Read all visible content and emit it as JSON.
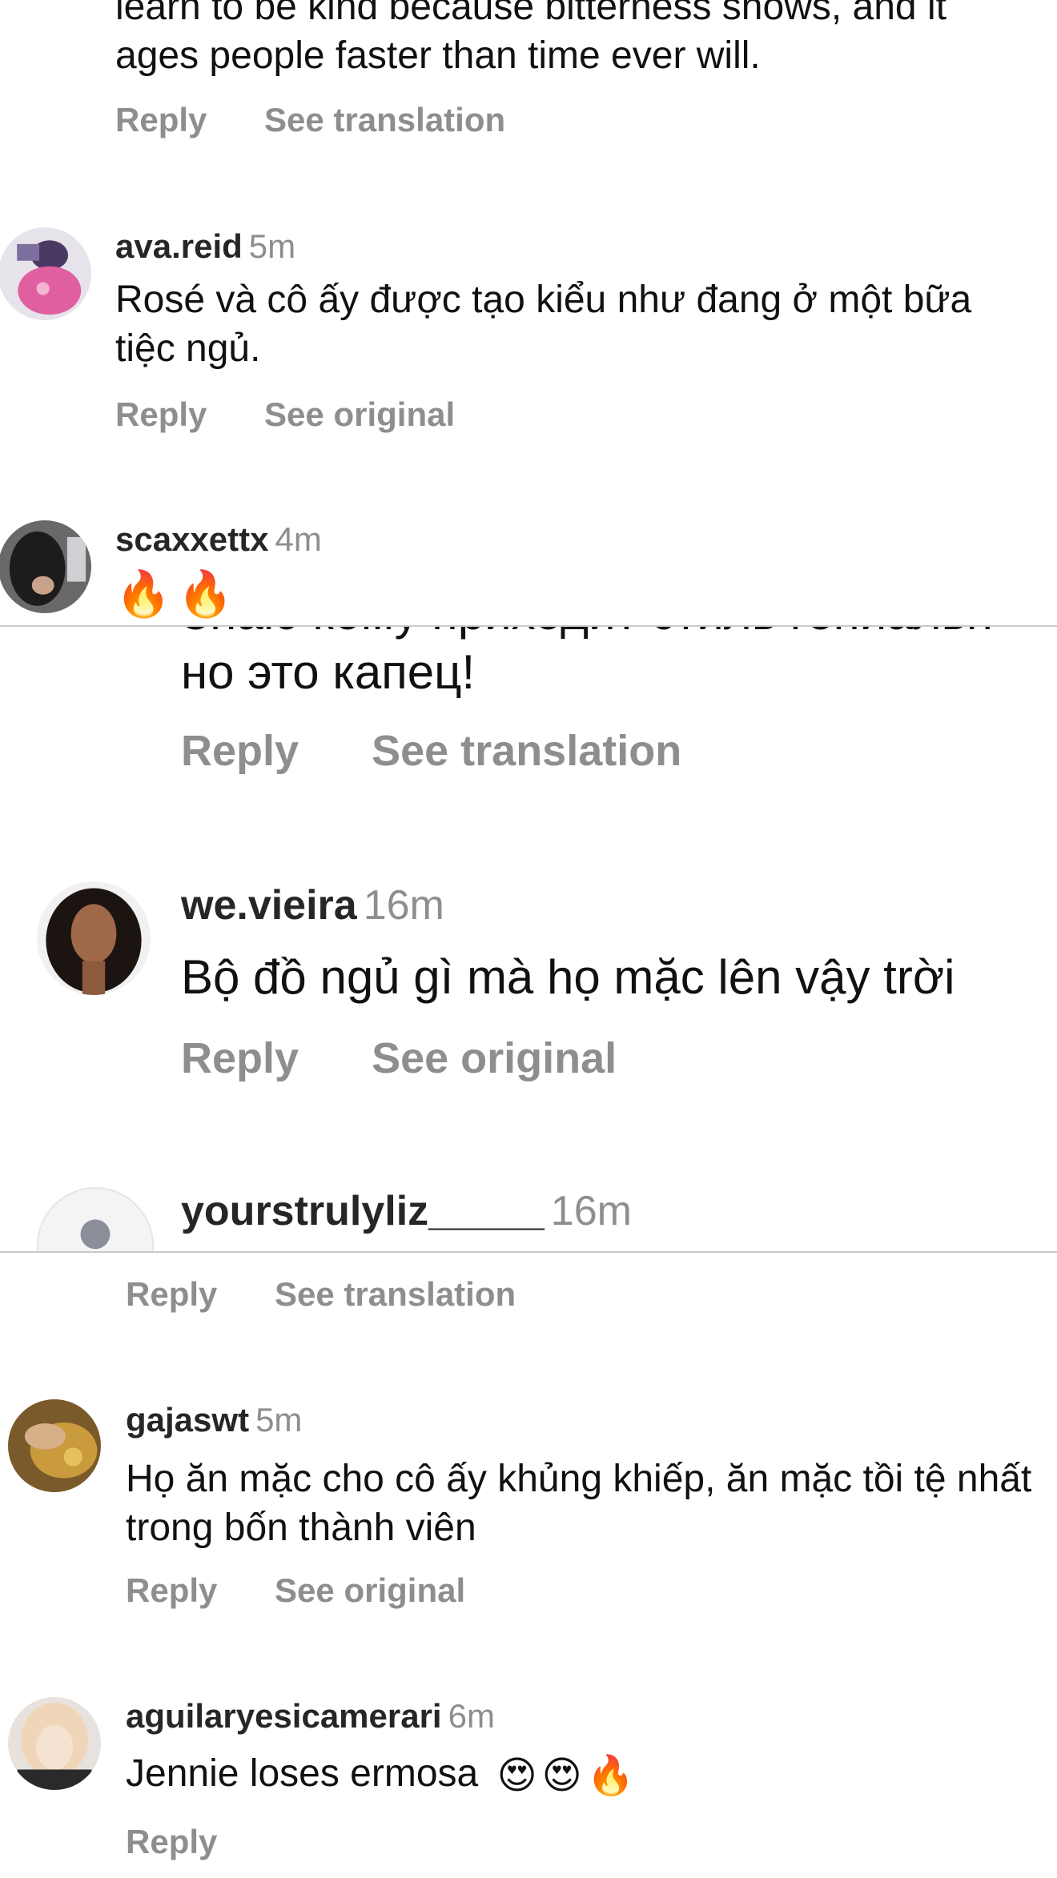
{
  "panel1": {
    "partial_comment": {
      "text_line_1": "learn to be kind because bitterness shows, and it",
      "text_line_2": "ages people faster than time ever will.",
      "reply": "Reply",
      "action": "See translation"
    },
    "comments": [
      {
        "user": "ava.reid",
        "time": "5m",
        "text": "Rosé và cô ấy được tạo kiểu như đang ở một bữa tiệc ngủ.",
        "reply": "Reply",
        "action": "See original"
      },
      {
        "user": "scaxxettx",
        "time": "4m",
        "text": "🔥🔥"
      }
    ]
  },
  "panel2": {
    "partial_comment": {
      "text_cut": "Знаю кому приходит стиль гениальн",
      "text_line": "но это капец!",
      "reply": "Reply",
      "action": "See translation"
    },
    "comments": [
      {
        "user": "we.vieira",
        "time": "16m",
        "text": "Bộ đồ ngủ gì mà họ mặc lên vậy trời",
        "reply": "Reply",
        "action": "See original"
      },
      {
        "user": "yourstrulyliz_____",
        "time": "16m"
      }
    ]
  },
  "panel3": {
    "partial_comment": {
      "reply": "Reply",
      "action": "See translation"
    },
    "comments": [
      {
        "user": "gajaswt",
        "time": "5m",
        "text": "Họ ăn mặc cho cô ấy khủng khiếp, ăn mặc tồi tệ nhất trong bốn thành viên",
        "reply": "Reply",
        "action": "See original"
      },
      {
        "user": "aguilaryesicamerari",
        "time": "6m",
        "text": "Jennie loses ermosa",
        "emoji_suffix": "😍😍🔥",
        "reply": "Reply"
      }
    ]
  },
  "colors": {
    "username": "#262626",
    "secondary": "#8e8e8e",
    "divider": "#c9c9ce"
  }
}
